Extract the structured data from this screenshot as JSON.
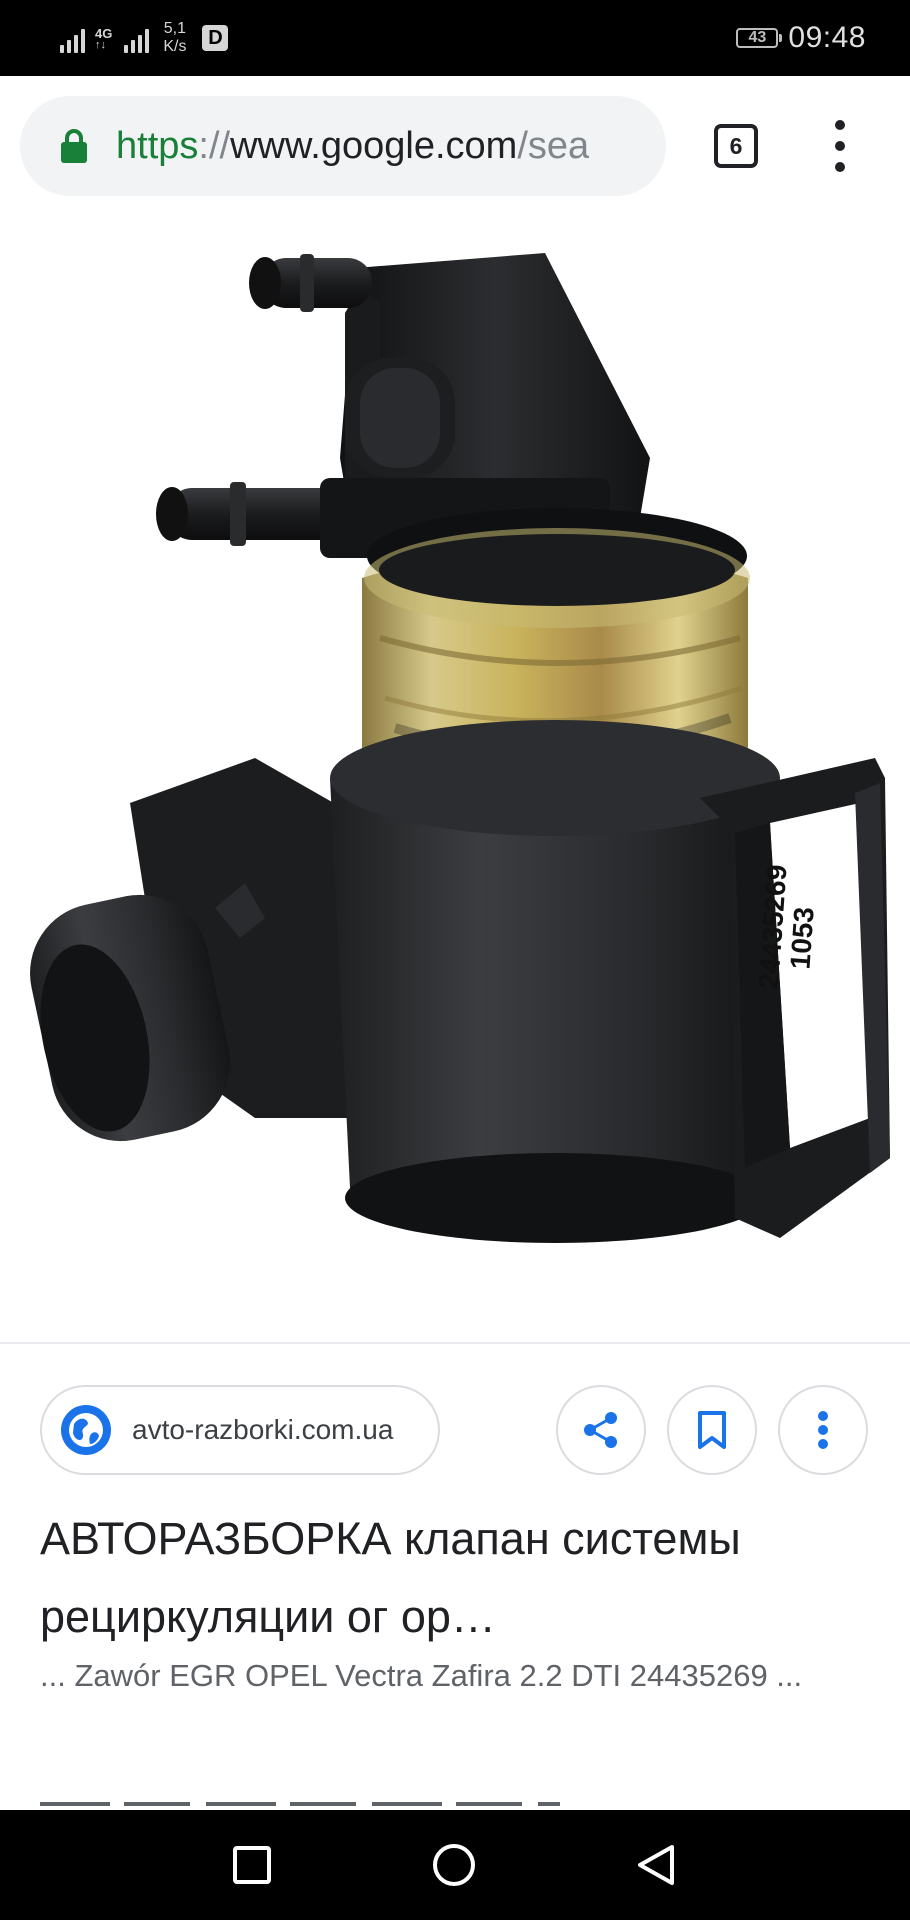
{
  "status_bar": {
    "network_label_1": "4G",
    "network_label_2": "4G",
    "speed_value": "5,1",
    "speed_unit": "K/s",
    "data_badge": "D",
    "battery_level": "43",
    "time": "09:48"
  },
  "browser": {
    "url_scheme": "https",
    "url_separator": "://",
    "url_host": "www.google.com",
    "url_path": "/sea",
    "tab_count": "6"
  },
  "image": {
    "label_code": "24435269",
    "label_code_2": "1053"
  },
  "result": {
    "source": "avto-razborki.com.ua",
    "title": "АВТОРАЗБОРКА клапан системы рециркуляции ог ор…",
    "snippet": "... Zawór EGR OPEL Vectra Zafira 2.2 DTI 24435269 ..."
  },
  "icons": {
    "lock": "lock-icon",
    "globe": "globe-icon",
    "share": "share-icon",
    "bookmark": "bookmark-icon",
    "more": "more-vert-icon",
    "recents": "square-icon",
    "home": "circle-icon",
    "back": "triangle-back-icon"
  },
  "colors": {
    "accent": "#1a73e8",
    "secure_green": "#188038"
  }
}
